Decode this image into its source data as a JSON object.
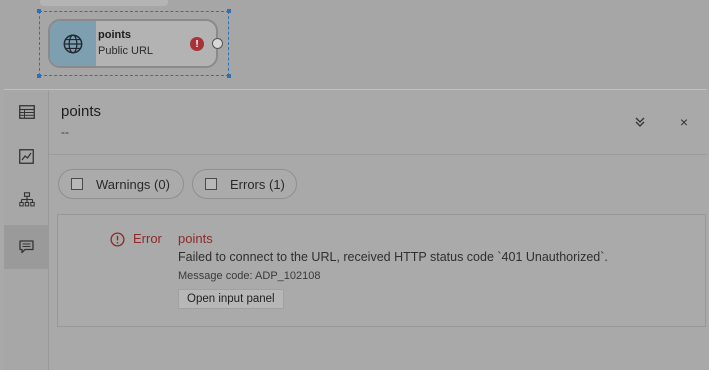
{
  "node": {
    "title": "points",
    "subtitle": "Public URL",
    "status_icon": "error-badge",
    "status_glyph": "!"
  },
  "panel": {
    "title": "points",
    "subtitle": "--",
    "rail": {
      "items": [
        {
          "name": "table-icon"
        },
        {
          "name": "chart-icon"
        },
        {
          "name": "hierarchy-icon"
        },
        {
          "name": "messages-icon",
          "active": true
        }
      ]
    },
    "header_actions": {
      "collapse_icon": "double-chevron-down-icon",
      "close_icon": "close-icon",
      "close_glyph": "×"
    },
    "filters": {
      "warnings_label": "Warnings (0)",
      "errors_label": "Errors (1)"
    },
    "message": {
      "level": "Error",
      "source": "points",
      "text": "Failed to connect to the URL, received HTTP status code `401 Unauthorized`.",
      "code": "Message code: ADP_102108",
      "action_label": "Open input panel"
    }
  },
  "colors": {
    "error": "#8c2a2a",
    "node_icon_bg": "#7e9fb0",
    "selection": "#2f6fb3"
  }
}
